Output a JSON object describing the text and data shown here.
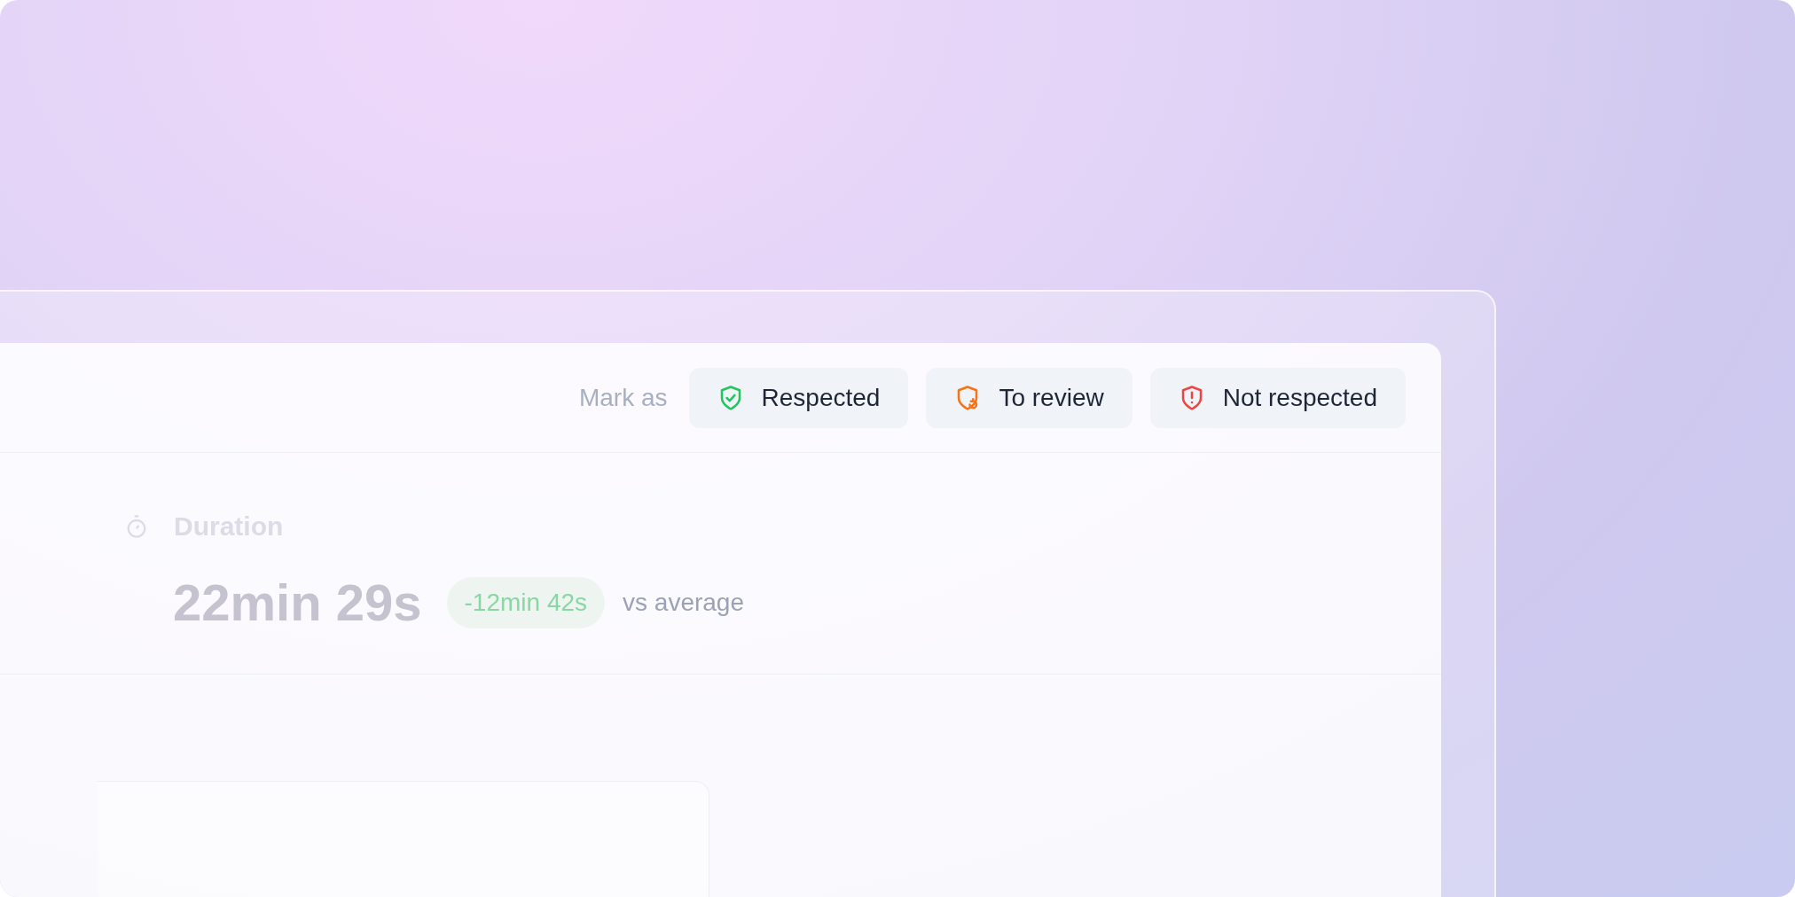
{
  "toolbar": {
    "label": "Mark as",
    "buttons": [
      {
        "kind": "respected",
        "label": "Respected"
      },
      {
        "kind": "review",
        "label": "To review"
      },
      {
        "kind": "not_respected",
        "label": "Not respected"
      }
    ]
  },
  "duration": {
    "label": "Duration",
    "value": "22min 29s",
    "delta": "-12min 42s",
    "comparison": "vs average"
  }
}
